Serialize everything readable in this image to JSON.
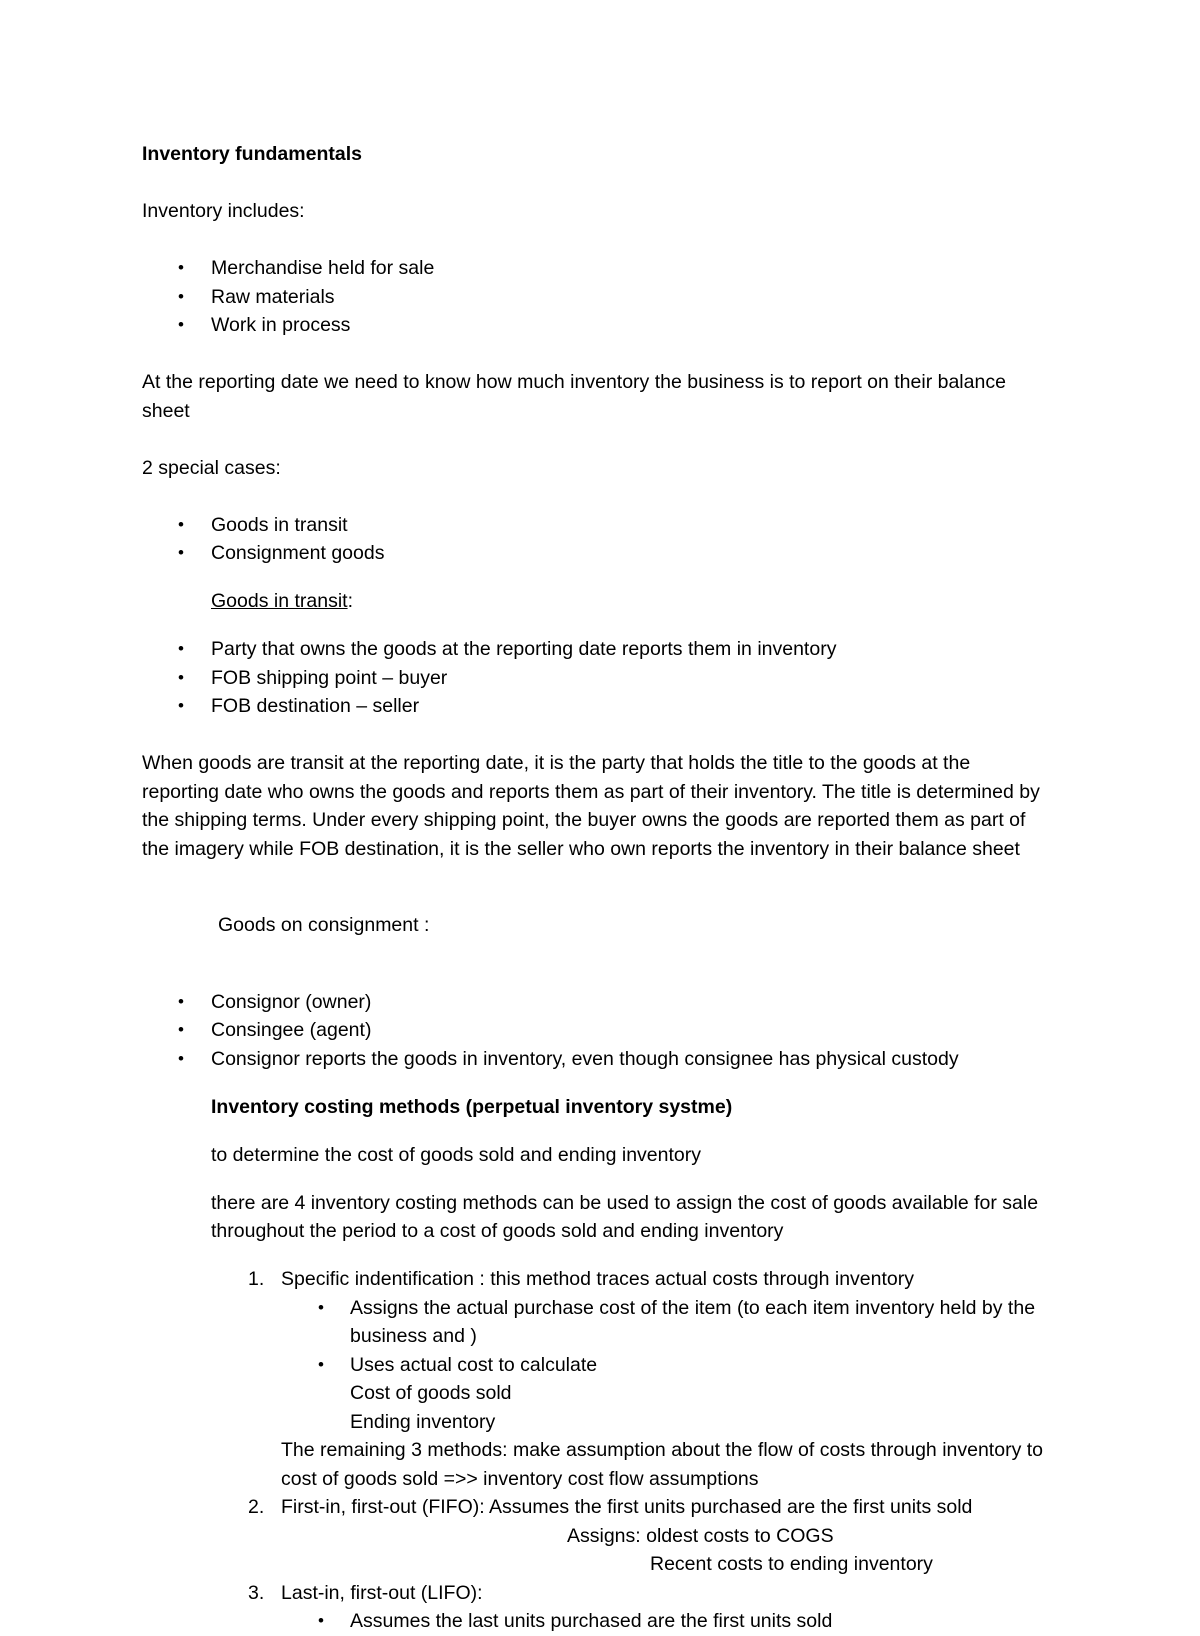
{
  "document": {
    "title": "Inventory fundamentals",
    "intro_label": "Inventory includes:",
    "inventory_includes": [
      "Merchandise held for sale",
      "Raw materials",
      "Work in process"
    ],
    "reporting_date_para": "At the reporting date we need to know how much inventory the business is to report on their balance sheet",
    "special_cases_label": "2 special cases:",
    "special_cases": [
      "Goods in transit",
      "Consignment goods"
    ],
    "goods_in_transit_heading": "Goods in transit",
    "goods_in_transit_heading_suffix": ":",
    "goods_in_transit_points": [
      "Party that owns the goods at the reporting date reports them in inventory",
      "FOB shipping point – buyer",
      "FOB destination – seller"
    ],
    "transit_explanation_para": "When goods are transit at the reporting date, it is the party that holds the title to the goods at the reporting date who owns the goods and reports them as part of their inventory. The title is determined by the shipping terms. Under every shipping point, the buyer owns the goods are reported them as part of the imagery while FOB destination, it is the seller who own reports the inventory in their balance sheet",
    "goods_on_consignment_label": " Goods on consignment :",
    "consignment_points": [
      "Consignor (owner)",
      "Consingee (agent)",
      "Consignor reports the goods in inventory, even though consignee has physical custody"
    ],
    "costing_methods_heading": "Inventory costing methods (perpetual inventory systme)",
    "costing_methods_lines": [
      "to determine the cost of goods sold and ending inventory",
      "there are 4 inventory costing methods can be used to assign the cost of goods available for sale throughout the period to a cost of goods sold and ending inventory"
    ],
    "methods": [
      {
        "number": "1.",
        "text": "Specific indentification : this method traces actual costs through inventory",
        "sub_bullets": [
          "Assigns the actual purchase cost of the item (to each item inventory held by the business and )",
          "Uses actual cost to calculate"
        ],
        "sub_continuations": [
          "Cost of goods sold",
          "Ending inventory"
        ],
        "after_lines": [
          "The remaining 3 methods: make assumption about the flow of costs through inventory to cost of goods sold =>> inventory cost flow assumptions"
        ]
      },
      {
        "number": "2.",
        "text": "First-in, first-out (FIFO): Assumes the first units purchased are the first units sold",
        "assigns_line": "Assigns: oldest costs to COGS",
        "recent_line": "Recent costs to ending inventory"
      },
      {
        "number": "3.",
        "text": "Last-in, first-out (LIFO):",
        "sub_bullets": [
          "Assumes the last units purchased are the first units sold"
        ]
      }
    ],
    "bullet_glyph": "•"
  }
}
